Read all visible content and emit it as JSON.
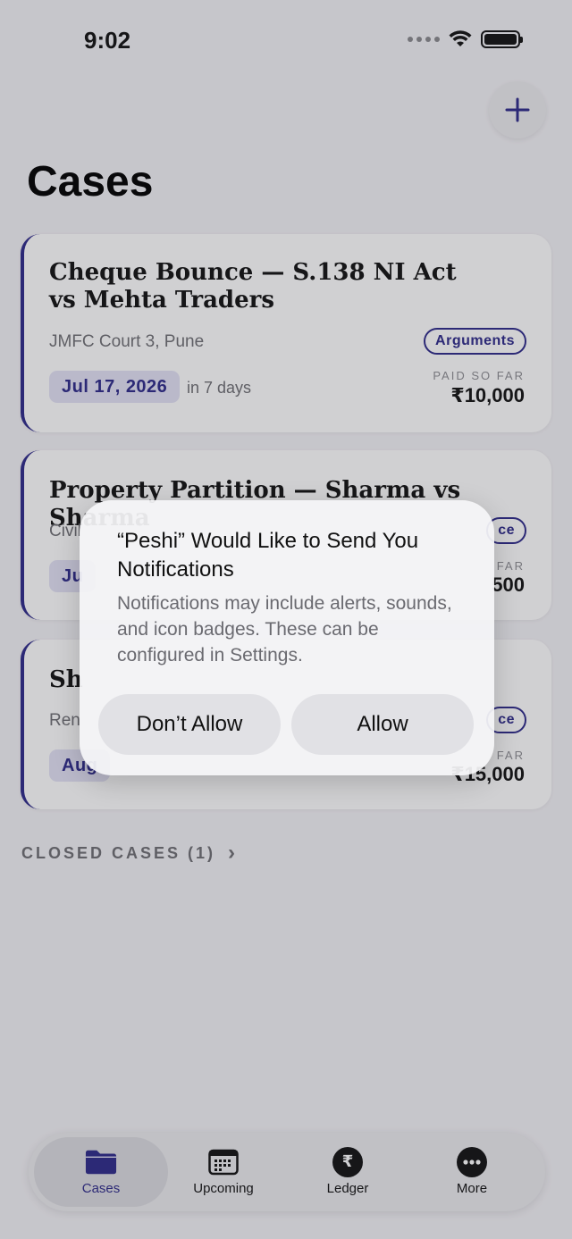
{
  "status_bar": {
    "time": "9:02"
  },
  "header": {
    "title": "Cases",
    "add_icon": "plus-icon"
  },
  "cases": [
    {
      "title": "Cheque Bounce — S.138 NI Act vs Mehta Traders",
      "court": "JMFC Court 3, Pune",
      "stage": "Arguments",
      "date": "Jul 17, 2026",
      "relative": "in 7 days",
      "paid_label": "PAID SO FAR",
      "paid_value": "₹10,000"
    },
    {
      "title": "Property Partition — Sharma vs Sharma",
      "court": "Civil",
      "stage": "ce",
      "date": "Ju",
      "paid_label": "FAR",
      "paid_value": "500"
    },
    {
      "title": "Sh",
      "court": "Ren",
      "stage": "ce",
      "date": "Aug",
      "paid_label": "FAR",
      "paid_value": "₹15,000"
    }
  ],
  "closed_cases": {
    "label": "CLOSED CASES (1)",
    "chevron": "›"
  },
  "tabbar": {
    "tabs": [
      {
        "label": "Cases",
        "icon": "folder-icon"
      },
      {
        "label": "Upcoming",
        "icon": "calendar-icon"
      },
      {
        "label": "Ledger",
        "icon": "rupee-icon",
        "glyph": "₹"
      },
      {
        "label": "More",
        "icon": "more-icon"
      }
    ]
  },
  "alert": {
    "title": "“Peshi” Would Like to Send You Notifications",
    "message": "Notifications may include alerts, sounds, and icon badges. These can be configured in Settings.",
    "deny": "Don’t Allow",
    "allow": "Allow"
  },
  "colors": {
    "accent": "#2e2a8a",
    "background": "#f3f2f6"
  }
}
